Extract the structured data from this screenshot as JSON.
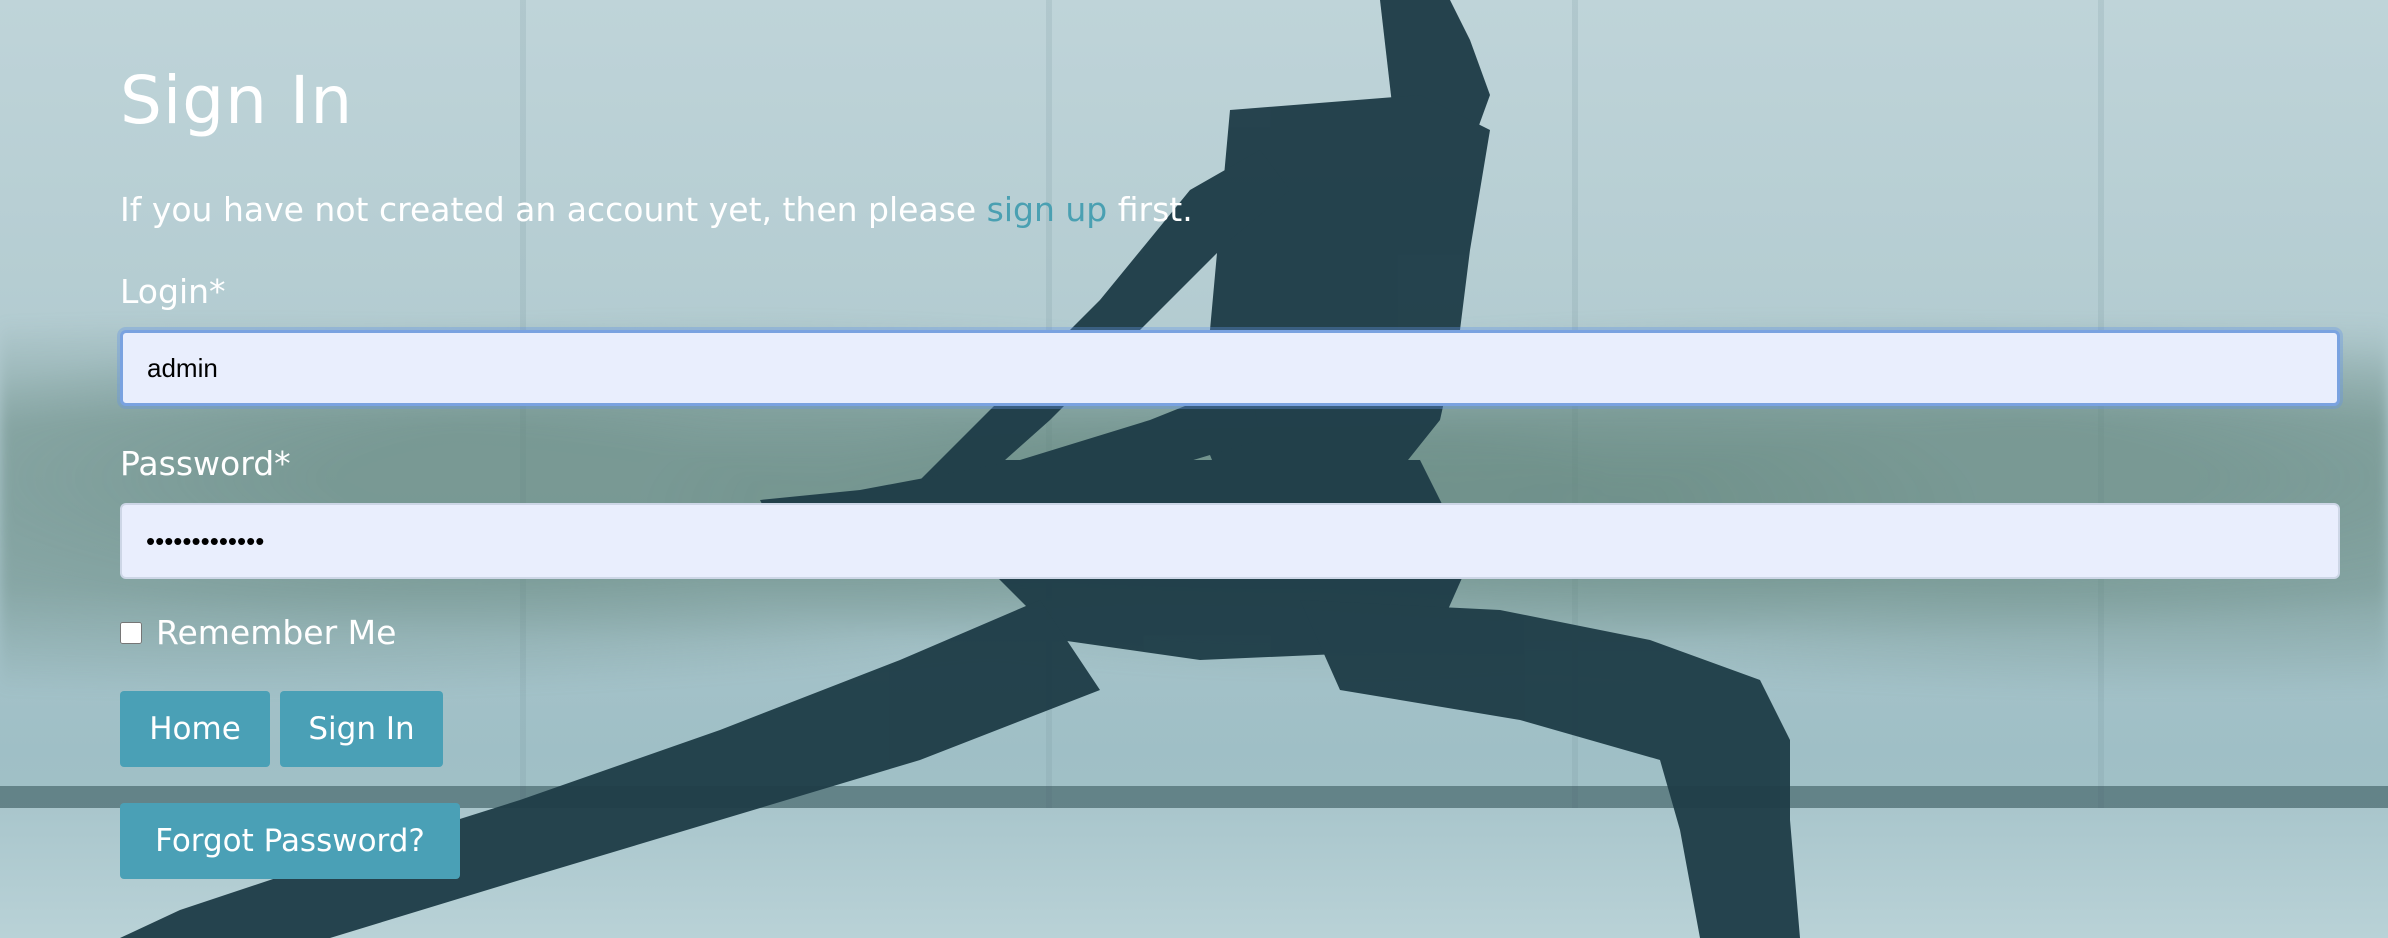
{
  "page": {
    "title": "Sign In"
  },
  "intro": {
    "before_link": "If you have not created an account yet, then please ",
    "link_text": "sign up",
    "after_link": " first."
  },
  "form": {
    "login_label": "Login*",
    "login_value": "admin",
    "password_label": "Password*",
    "password_value": "•••••••••••••",
    "remember_label": "Remember Me",
    "remember_checked": false
  },
  "buttons": {
    "home_label": "Home",
    "signin_label": "Sign In",
    "forgot_label": "Forgot Password?"
  },
  "colors": {
    "accent": "#4aa0b6",
    "link": "#4aa0b2",
    "field_bg": "#e9eefd",
    "text": "#ffffff"
  },
  "background": {
    "subject": "yoga-silhouette-icon"
  }
}
